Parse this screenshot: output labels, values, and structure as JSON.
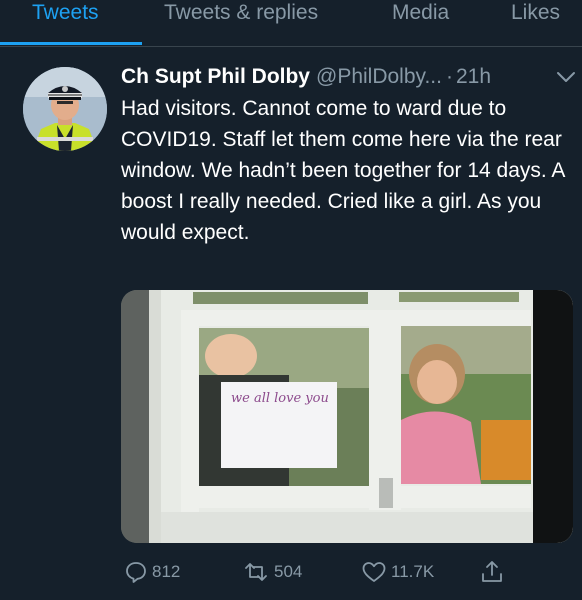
{
  "tabs": [
    {
      "label": "Tweets",
      "active": true
    },
    {
      "label": "Tweets & replies",
      "active": false
    },
    {
      "label": "Media",
      "active": false
    },
    {
      "label": "Likes",
      "active": false
    }
  ],
  "tweet": {
    "display_name": "Ch Supt Phil Dolby",
    "handle": "@PhilDolby...",
    "separator": "·",
    "time": "21h",
    "text": "Had visitors. Cannot come to ward due to COVID19. Staff let them come here via the rear window. We hadn’t been together for 14 days. A boost I really needed. Cried like a girl. As you would expect.",
    "photo_sign_text": "we all love you",
    "actions": {
      "replies": "812",
      "retweets": "504",
      "likes": "11.7K"
    }
  },
  "colors": {
    "background": "#15202b",
    "accent": "#1da1f2",
    "muted": "#8899a6",
    "divider": "#38444d"
  },
  "icons": {
    "reply": "reply-icon",
    "retweet": "retweet-icon",
    "like": "heart-icon",
    "share": "share-icon",
    "menu": "chevron-down-icon"
  }
}
